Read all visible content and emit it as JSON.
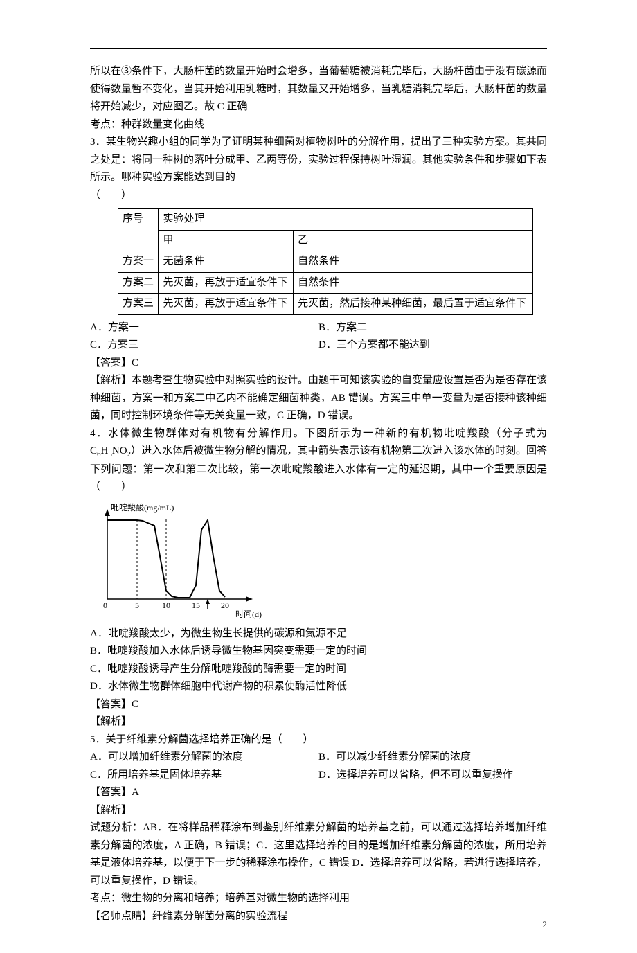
{
  "para_top": "所以在③条件下，大肠杆菌的数量开始时会增多，当葡萄糖被消耗完毕后，大肠杆菌由于没有碳源而使得数量暂不变化，当其开始利用乳糖时，其数量又开始增多，当乳糖消耗完毕后，大肠杆菌的数量将开始减少，对应图乙。故 C 正确",
  "kaodian_top": "考点：种群数量变化曲线",
  "q3": {
    "stem": "3．某生物兴趣小组的同学为了证明某种细菌对植物树叶的分解作用，提出了三种实验方案。其共同之处是：将同一种树的落叶分成甲、乙两等份，实验过程保持树叶湿润。其他实验条件和步骤如下表所示。哪种实验方案能达到目的",
    "blank": "（　　）",
    "table": {
      "h1": "序号",
      "h2": "实验处理",
      "c1": "甲",
      "c2": "乙",
      "r1n": "方案一",
      "r1a": "无菌条件",
      "r1b": "自然条件",
      "r2n": "方案二",
      "r2a": "先灭菌，再放于适宜条件下",
      "r2b": "自然条件",
      "r3n": "方案三",
      "r3a": "先灭菌，再放于适宜条件下",
      "r3b": "先灭菌，然后接种某种细菌，最后置于适宜条件下"
    },
    "optA": "A．方案一",
    "optB": "B．方案二",
    "optC": " C．方案三",
    "optD": "D．三个方案都不能达到",
    "ans": "【答案】C",
    "expl": "【解析】本题考查生物实验中对照实验的设计。由题干可知该实验的自变量应设置是否为是否存在该种细菌，方案一和方案二中乙内不能确定细菌种类，AB 错误。方案三中单一变量为是否接种该种细菌，同时控制环境条件等无关变量一致，C 正确，D 错误。"
  },
  "q4": {
    "stem_pre": "4．水体微生物群体对有机物有分解作用。下图所示为一种新的有机物吡啶羧酸（分子式为 C",
    "sub1": "6",
    "mid1": "H",
    "sub2": "5",
    "mid2": "NO",
    "sub3": "2",
    "stem_post": "）进入水体后被微生物分解的情况，其中箭头表示该有机物第二次进入该水体的时刻。回答下列问题：第一次和第二次比较，第一次吡啶羧酸进入水体有一定的延迟期，其中一个重要原因是（　　）",
    "optA": "A．吡啶羧酸太少，为微生物生长提供的碳源和氮源不足",
    "optB": "B．吡啶羧酸加入水体后诱导微生物基因突变需要一定的时间",
    "optC": "C．吡啶羧酸诱导产生分解吡啶羧酸的酶需要一定的时间",
    "optD": "D．水体微生物群体细胞中代谢产物的积累使酶活性降低",
    "ans": "【答案】C",
    "expl": "【解析】"
  },
  "q5": {
    "stem": "5．关于纤维素分解菌选择培养正确的是（　　）",
    "optA": "A．可以增加纤维素分解菌的浓度",
    "optB": "B．可以减少纤维素分解菌的浓度",
    "optC": "C．所用培养基是固体培养基",
    "optD": "D．选择培养可以省略，但不可以重复操作",
    "ans": "【答案】A",
    "expl_h": "【解析】",
    "expl": "试题分析：AB．在将样品稀释涂布到鉴别纤维素分解菌的培养基之前，可以通过选择培养增加纤维素分解菌的浓度，A 正确，B 错误；C．这里选择培养的目的是增加纤维素分解菌的浓度，所用培养基是液体培养基，以便于下一步的稀释涂布操作，C 错误 D．选择培养可以省略，若进行选择培养，可以重复操作，D 错误。",
    "kaodian": "考点：微生物的分离和培养；培养基对微生物的选择利用",
    "ming": "【名师点睛】纤维素分解菌分离的实验流程"
  },
  "chart_data": {
    "type": "line",
    "title": "",
    "ylabel": "吡啶羧酸(mg/mL)",
    "xlabel": "时间(d)",
    "x": [
      0,
      2,
      4,
      5,
      6,
      8,
      9,
      10,
      11,
      12,
      14,
      15,
      16,
      17,
      18,
      19,
      20
    ],
    "y": [
      9.5,
      9.5,
      9.5,
      9.5,
      9.4,
      8.5,
      5,
      1,
      0.3,
      0.1,
      0.1,
      2,
      8,
      9.5,
      5,
      1,
      0.2
    ],
    "xlim": [
      0,
      22
    ],
    "ylim": [
      0,
      10
    ],
    "dashed_x": [
      5,
      10
    ],
    "arrow_x": 17
  },
  "page_num": "2"
}
